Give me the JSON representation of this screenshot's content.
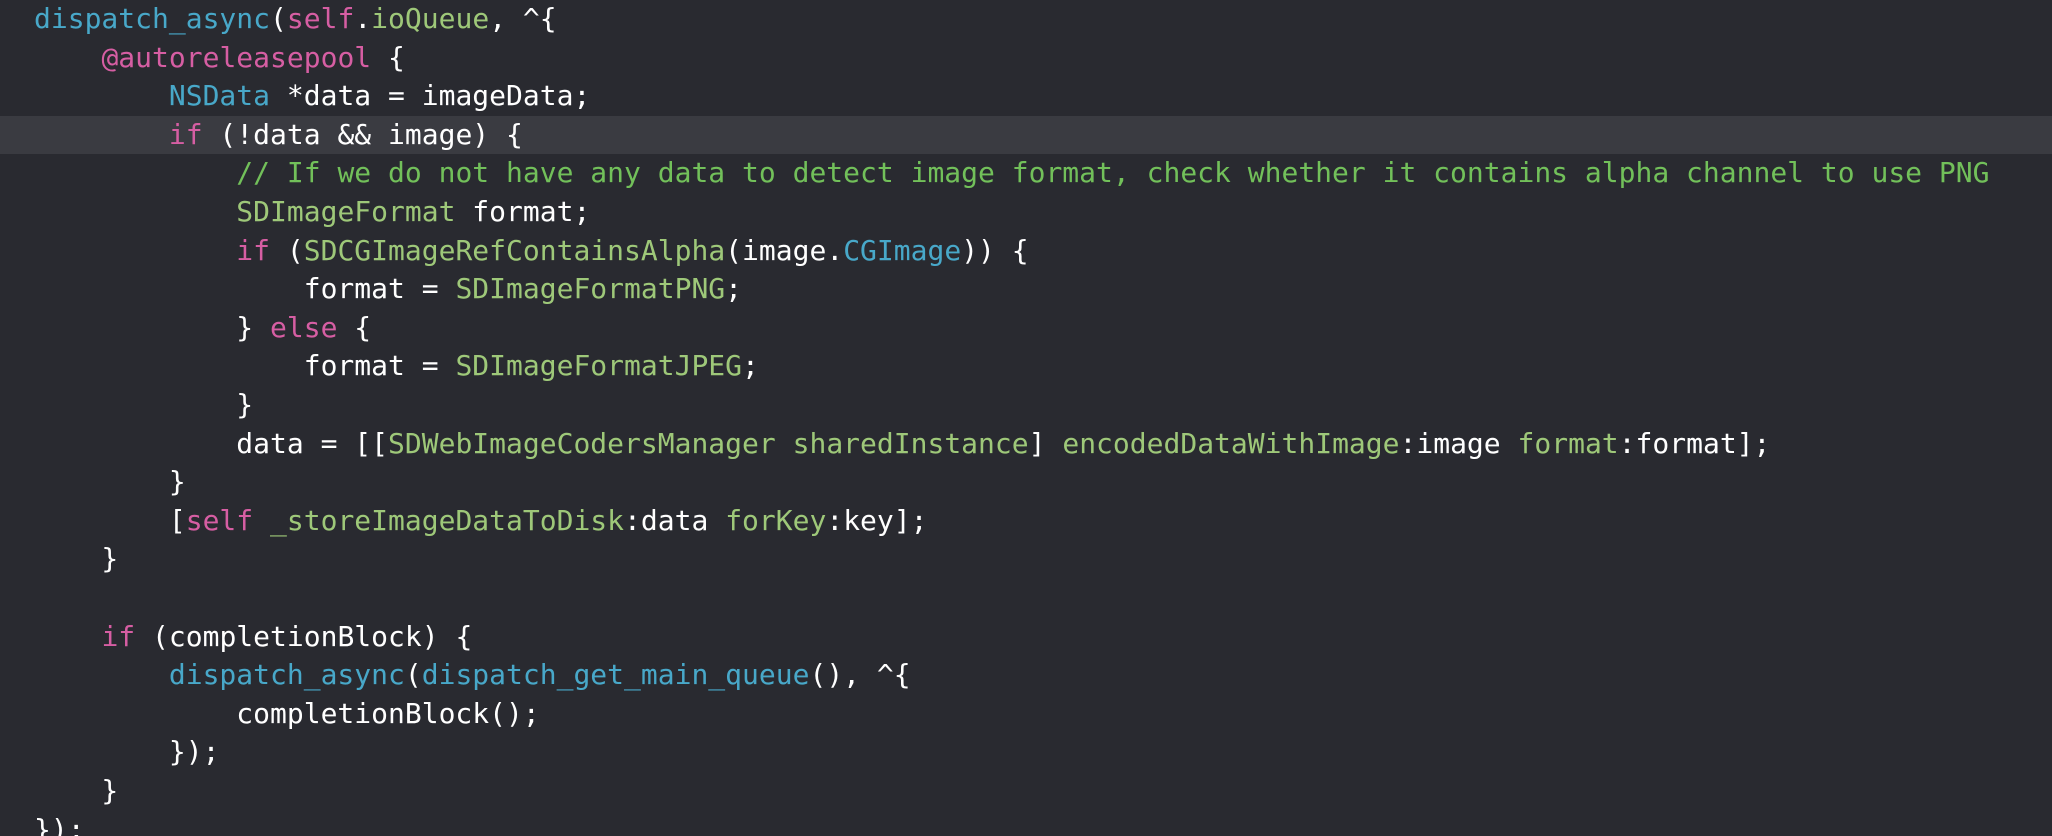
{
  "editor": {
    "theme": {
      "background": "#292a30",
      "current_line_background": "#3a3b41",
      "plain": "#ffffff",
      "keyword": "#d65ea3",
      "system_type": "#48a8c9",
      "project_symbol": "#9ec879",
      "comment": "#72c05a"
    },
    "current_line_index": 3,
    "lines": [
      [
        [
          "type",
          "dispatch_async"
        ],
        [
          "plain",
          "("
        ],
        [
          "keyword",
          "self"
        ],
        [
          "plain",
          "."
        ],
        [
          "project",
          "ioQueue"
        ],
        [
          "plain",
          ", ^{"
        ]
      ],
      [
        [
          "plain",
          "    "
        ],
        [
          "keyword",
          "@autoreleasepool"
        ],
        [
          "plain",
          " {"
        ]
      ],
      [
        [
          "plain",
          "        "
        ],
        [
          "type",
          "NSData"
        ],
        [
          "plain",
          " *data = imageData;"
        ]
      ],
      [
        [
          "plain",
          "        "
        ],
        [
          "keyword",
          "if"
        ],
        [
          "plain",
          " (!data && image) {"
        ]
      ],
      [
        [
          "plain",
          "            "
        ],
        [
          "comment",
          "// If we do not have any data to detect image format, check whether it contains alpha channel to use PNG"
        ]
      ],
      [
        [
          "plain",
          "            "
        ],
        [
          "project",
          "SDImageFormat"
        ],
        [
          "plain",
          " format;"
        ]
      ],
      [
        [
          "plain",
          "            "
        ],
        [
          "keyword",
          "if"
        ],
        [
          "plain",
          " ("
        ],
        [
          "project",
          "SDCGImageRefContainsAlpha"
        ],
        [
          "plain",
          "(image."
        ],
        [
          "type",
          "CGImage"
        ],
        [
          "plain",
          ")) {"
        ]
      ],
      [
        [
          "plain",
          "                format = "
        ],
        [
          "project",
          "SDImageFormatPNG"
        ],
        [
          "plain",
          ";"
        ]
      ],
      [
        [
          "plain",
          "            } "
        ],
        [
          "keyword",
          "else"
        ],
        [
          "plain",
          " {"
        ]
      ],
      [
        [
          "plain",
          "                format = "
        ],
        [
          "project",
          "SDImageFormatJPEG"
        ],
        [
          "plain",
          ";"
        ]
      ],
      [
        [
          "plain",
          "            }"
        ]
      ],
      [
        [
          "plain",
          "            data = [["
        ],
        [
          "project",
          "SDWebImageCodersManager"
        ],
        [
          "plain",
          " "
        ],
        [
          "project",
          "sharedInstance"
        ],
        [
          "plain",
          "] "
        ],
        [
          "project",
          "encodedDataWithImage"
        ],
        [
          "plain",
          ":image "
        ],
        [
          "project",
          "format"
        ],
        [
          "plain",
          ":format];"
        ]
      ],
      [
        [
          "plain",
          "        }"
        ]
      ],
      [
        [
          "plain",
          "        ["
        ],
        [
          "keyword",
          "self"
        ],
        [
          "plain",
          " "
        ],
        [
          "project",
          "_storeImageDataToDisk"
        ],
        [
          "plain",
          ":data "
        ],
        [
          "project",
          "forKey"
        ],
        [
          "plain",
          ":key];"
        ]
      ],
      [
        [
          "plain",
          "    }"
        ]
      ],
      [],
      [
        [
          "plain",
          "    "
        ],
        [
          "keyword",
          "if"
        ],
        [
          "plain",
          " (completionBlock) {"
        ]
      ],
      [
        [
          "plain",
          "        "
        ],
        [
          "type",
          "dispatch_async"
        ],
        [
          "plain",
          "("
        ],
        [
          "type",
          "dispatch_get_main_queue"
        ],
        [
          "plain",
          "(), ^{"
        ]
      ],
      [
        [
          "plain",
          "            completionBlock();"
        ]
      ],
      [
        [
          "plain",
          "        });"
        ]
      ],
      [
        [
          "plain",
          "    }"
        ]
      ],
      [
        [
          "plain",
          "});"
        ]
      ]
    ]
  }
}
